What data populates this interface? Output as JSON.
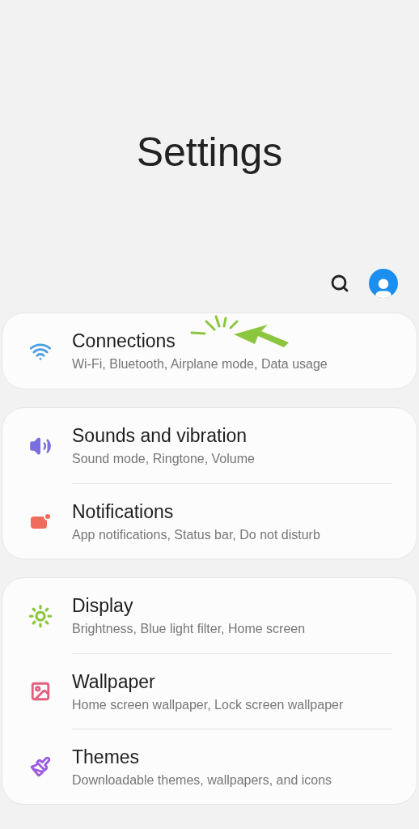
{
  "header": {
    "title": "Settings"
  },
  "groups": [
    {
      "items": [
        {
          "kind": "wifi",
          "title": "Connections",
          "subtitle": "Wi-Fi, Bluetooth, Airplane mode, Data usage"
        }
      ]
    },
    {
      "items": [
        {
          "kind": "sound",
          "title": "Sounds and vibration",
          "subtitle": "Sound mode, Ringtone, Volume"
        },
        {
          "kind": "notifications",
          "title": "Notifications",
          "subtitle": "App notifications, Status bar, Do not disturb"
        }
      ]
    },
    {
      "items": [
        {
          "kind": "display",
          "title": "Display",
          "subtitle": "Brightness, Blue light filter, Home screen"
        },
        {
          "kind": "wallpaper",
          "title": "Wallpaper",
          "subtitle": "Home screen wallpaper, Lock screen wallpaper"
        },
        {
          "kind": "themes",
          "title": "Themes",
          "subtitle": "Downloadable themes, wallpapers, and icons"
        }
      ]
    }
  ]
}
